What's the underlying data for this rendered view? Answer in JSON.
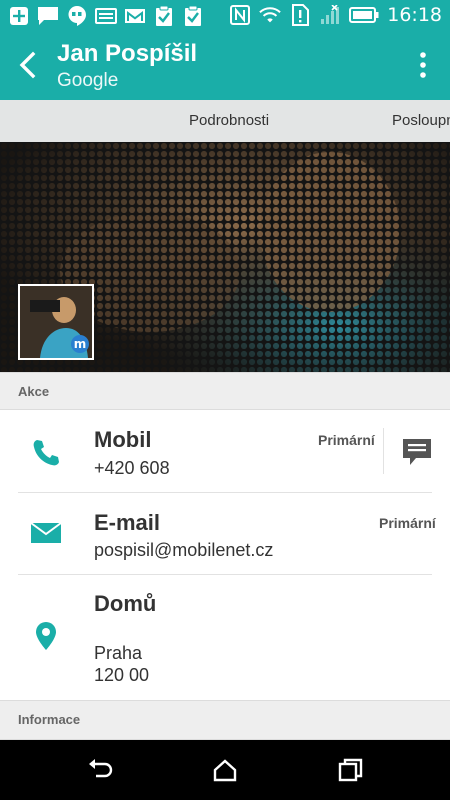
{
  "status_bar": {
    "time": "16:18",
    "left_icons": [
      "add-icon",
      "chat-icon",
      "hangouts-icon",
      "keyboard-icon",
      "gmail-icon",
      "clipboard-check-icon",
      "clipboard-check-icon"
    ],
    "right_icons": [
      "nfc-icon",
      "wifi-icon",
      "sim-alert-icon",
      "signal-icon",
      "battery-icon"
    ]
  },
  "app_bar": {
    "title": "Jan Pospíšil",
    "subtitle": "Google"
  },
  "tabs": [
    {
      "label": "Podrobnosti"
    },
    {
      "label": "Posloupnost"
    }
  ],
  "sections": {
    "actions_header": "Akce",
    "info_header": "Informace"
  },
  "contacts": [
    {
      "label": "Mobil",
      "value": "+420 608",
      "badge": "Primární",
      "icon": "phone-icon",
      "action_icon": "message-icon"
    },
    {
      "label": "E-mail",
      "value": "pospisil@mobilenet.cz",
      "badge": "Primární",
      "icon": "email-icon"
    },
    {
      "label": "Domů",
      "value_line1": "Praha",
      "value_line2": "120 00",
      "icon": "location-pin-icon"
    }
  ],
  "colors": {
    "accent": "#1aaea8",
    "tab_bar": "#e3e5e5",
    "section_bg": "#eeeeee"
  }
}
